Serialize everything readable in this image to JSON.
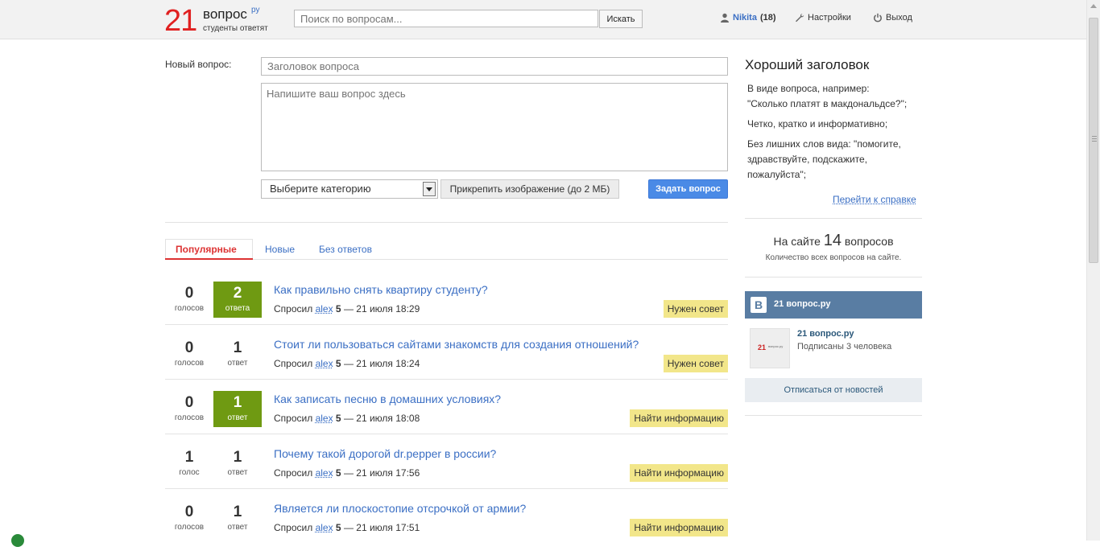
{
  "header": {
    "logo_number": "21",
    "logo_word": "вопрос",
    "logo_ru": "ру",
    "logo_tagline": "студенты ответят",
    "search_placeholder": "Поиск по вопросам...",
    "search_button": "Искать",
    "user_name": "Nikita",
    "user_count": "(18)",
    "settings_label": "Настройки",
    "logout_label": "Выход"
  },
  "form": {
    "label": "Новый вопрос:",
    "title_placeholder": "Заголовок вопроса",
    "body_placeholder": "Напишите ваш вопрос здесь",
    "category_selected": "Выберите категорию",
    "attach_label": "Прикрепить изображение (до 2 МБ)",
    "submit_label": "Задать вопрос"
  },
  "tabs": [
    {
      "label": "Популярные",
      "active": true
    },
    {
      "label": "Новые",
      "active": false
    },
    {
      "label": "Без ответов",
      "active": false
    }
  ],
  "questions": [
    {
      "votes": "0",
      "votes_label": "голосов",
      "answers": "2",
      "answers_label": "ответа",
      "highlighted": true,
      "title": "Как правильно снять квартиру студенту?",
      "asked": "Спросил",
      "author": "alex",
      "karma": "5",
      "date": "— 21 июля 18:29",
      "tag": "Нужен совет"
    },
    {
      "votes": "0",
      "votes_label": "голосов",
      "answers": "1",
      "answers_label": "ответ",
      "highlighted": false,
      "title": "Стоит ли пользоваться сайтами знакомств для создания отношений?",
      "asked": "Спросил",
      "author": "alex",
      "karma": "5",
      "date": "— 21 июля 18:24",
      "tag": "Нужен совет"
    },
    {
      "votes": "0",
      "votes_label": "голосов",
      "answers": "1",
      "answers_label": "ответ",
      "highlighted": true,
      "title": "Как записать песню в домашних условиях?",
      "asked": "Спросил",
      "author": "alex",
      "karma": "5",
      "date": "— 21 июля 18:08",
      "tag": "Найти информацию"
    },
    {
      "votes": "1",
      "votes_label": "голос",
      "answers": "1",
      "answers_label": "ответ",
      "highlighted": false,
      "title": "Почему такой дорогой dr.pepper в россии?",
      "asked": "Спросил",
      "author": "alex",
      "karma": "5",
      "date": "— 21 июля 17:56",
      "tag": "Найти информацию"
    },
    {
      "votes": "0",
      "votes_label": "голосов",
      "answers": "1",
      "answers_label": "ответ",
      "highlighted": false,
      "title": "Является ли плоскостопие отсрочкой от армии?",
      "asked": "Спросил",
      "author": "alex",
      "karma": "5",
      "date": "— 21 июля 17:51",
      "tag": "Найти информацию"
    }
  ],
  "sidebar": {
    "title": "Хороший заголовок",
    "tip1_line1": "В виде вопроса, например:",
    "tip1_line2": "\"Сколько платят в макдональдсе?\";",
    "tip2": "Четко, кратко и информативно;",
    "tip3": "Без лишних слов вида: \"помогите, здравствуйте, подскажите, пожалуйста\";",
    "help_link": "Перейти к справке",
    "stat_prefix": "На сайте",
    "stat_number": "14",
    "stat_suffix": "вопросов",
    "stat_sub": "Количество всех вопросов на сайте."
  },
  "vk_widget": {
    "logo": "B",
    "header_title": "21 вопрос.ру",
    "thumb_number": "21",
    "thumb_word": "вопрос.ру",
    "group_name": "21 вопрос.ру",
    "subscribers": "Подписаны 3 человека",
    "unsubscribe": "Отписаться от новостей"
  },
  "colors": {
    "accent_red": "#d33333",
    "link_blue": "#3b6fc4",
    "answers_green": "#6f9a12",
    "tag_yellow": "#f2e68a",
    "vk_blue": "#597da3",
    "button_blue": "#4a8ae6"
  }
}
